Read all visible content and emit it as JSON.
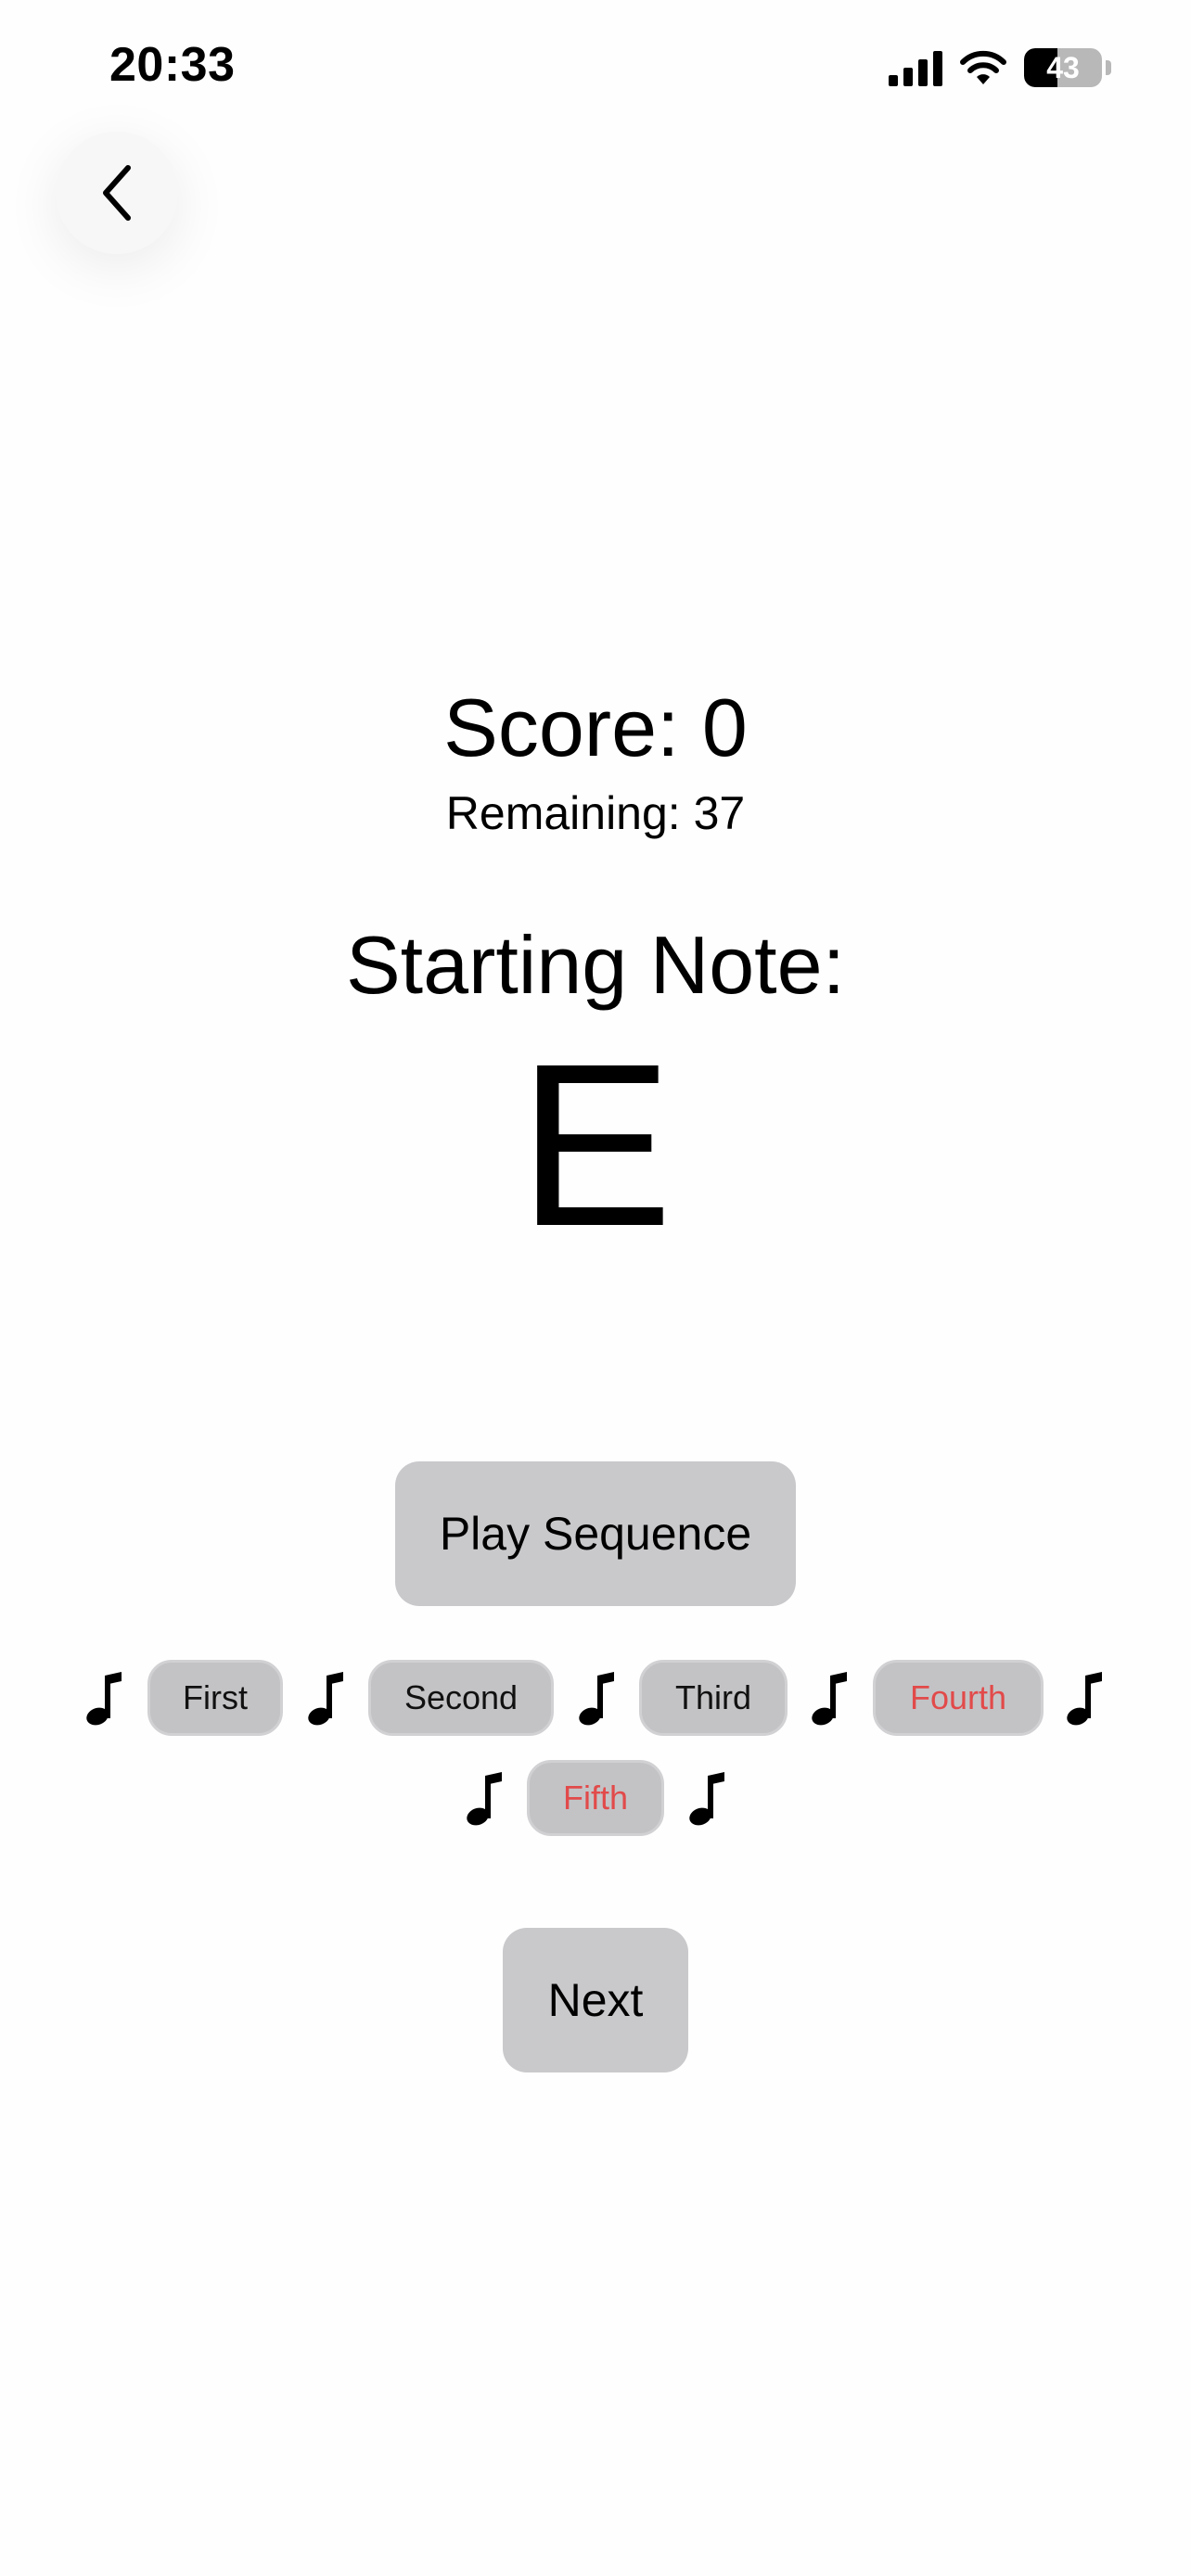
{
  "status_bar": {
    "time": "20:33",
    "battery": "43",
    "battery_level": 0.43
  },
  "icons": {
    "back": "chevron-left-icon",
    "note": "music-note-icon",
    "signal": "cellular-signal-icon",
    "wifi": "wifi-icon",
    "battery": "battery-icon"
  },
  "game": {
    "score_text": "Score: 0",
    "remaining_text": "Remaining: 37",
    "starting_label": "Starting Note:",
    "starting_note": "E"
  },
  "buttons": {
    "play": "Play Sequence",
    "next": "Next"
  },
  "sequence": [
    {
      "label": "First",
      "highlight": false
    },
    {
      "label": "Second",
      "highlight": false
    },
    {
      "label": "Third",
      "highlight": false
    },
    {
      "label": "Fourth",
      "highlight": true
    },
    {
      "label": "Fifth",
      "highlight": true
    }
  ],
  "colors": {
    "button_bg": "#c9c9cc",
    "highlight_text": "#e24a4a"
  }
}
